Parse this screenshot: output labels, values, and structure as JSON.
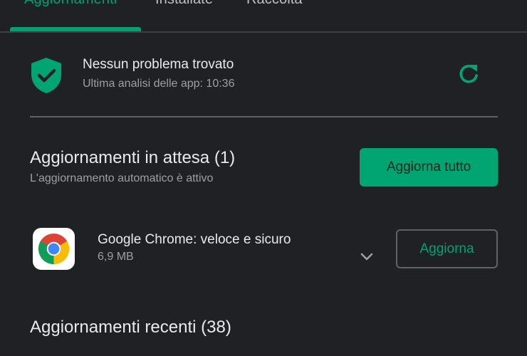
{
  "tabs": [
    {
      "label": "Aggiornamenti",
      "active": true
    },
    {
      "label": "Installate",
      "active": false
    },
    {
      "label": "Raccolta",
      "active": false
    }
  ],
  "security": {
    "title": "Nessun problema trovato",
    "subtitle": "Ultima analisi delle app: 10:36",
    "icon": "shield-check-icon",
    "refresh_icon": "refresh-icon"
  },
  "pending": {
    "title": "Aggiornamenti in attesa (1)",
    "subtitle": "L'aggiornamento automatico è attivo",
    "update_all_label": "Aggiorna tutto"
  },
  "apps": [
    {
      "name": "Google Chrome: veloce e sicuro",
      "size": "6,9 MB",
      "icon": "chrome-icon",
      "update_label": "Aggiorna"
    }
  ],
  "recent": {
    "title": "Aggiornamenti recenti (38)"
  },
  "colors": {
    "background": "#202124",
    "accent": "#01a572",
    "text_primary": "#e8eaed",
    "text_secondary": "#9aa0a6"
  }
}
